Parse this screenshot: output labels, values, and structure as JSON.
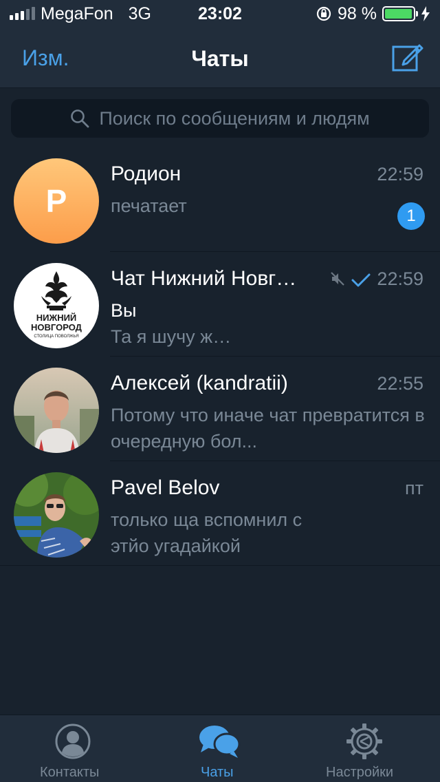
{
  "status_bar": {
    "carrier": "MegaFon",
    "network": "3G",
    "time": "23:02",
    "battery": "98 %",
    "battery_level": 0.98
  },
  "nav": {
    "edit_label": "Изм.",
    "title": "Чаты"
  },
  "search": {
    "placeholder": "Поиск по сообщениям и людям"
  },
  "chats": [
    {
      "name": "Родион",
      "time": "22:59",
      "message": "печатает",
      "unread": "1",
      "avatar_letter": "Р",
      "avatar_colors": [
        "#ffc77a",
        "#fc9d4a"
      ]
    },
    {
      "name": "Чат Нижний Новг…",
      "time": "22:59",
      "sender": "Вы",
      "message": "Та я шучу ж…",
      "muted": true,
      "read": true,
      "logo_line1": "НИЖНИЙ",
      "logo_line2": "НОВГОРОД",
      "logo_line3": "СТОЛИЦА ПОВОЛЖЬЯ"
    },
    {
      "name": "Алексей (kandratii)",
      "time": "22:55",
      "message": "Потому что иначе чат превратится в очередную бол..."
    },
    {
      "name": "Pavel Belov",
      "time": "пт",
      "message": "только ща вспомнил с этйо угадайкой"
    }
  ],
  "tabs": [
    {
      "label": "Контакты",
      "icon": "person-icon",
      "active": false
    },
    {
      "label": "Чаты",
      "icon": "chat-bubbles-icon",
      "active": true
    },
    {
      "label": "Настройки",
      "icon": "gear-icon",
      "active": false
    }
  ],
  "colors": {
    "background": "#18222d",
    "header": "#212d3b",
    "accent": "#4aa1e8",
    "badge": "#2f9bf1",
    "secondary_text": "#7a8896"
  }
}
